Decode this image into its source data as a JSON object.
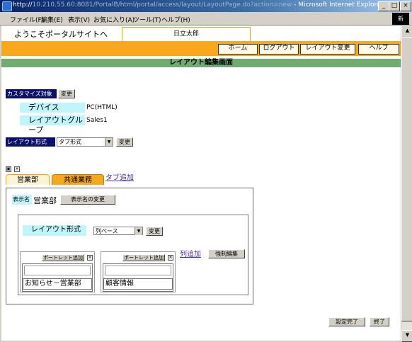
{
  "browser": {
    "title_prefix": "http://",
    "title_url": "10.210.55.60:8081/PortalB/html/portal/access/layout/LayoutPage.do?action=new",
    "title_suffix": " - Microsoft Internet Explorer",
    "menu": [
      "ファイル(F)",
      "編集(E)",
      "表示(V)",
      "お気に入り(A)",
      "ツール(T)",
      "ヘルプ(H)"
    ],
    "throbber": "新"
  },
  "header": {
    "welcome": "ようこそポータルサイトへ",
    "user": "日立太郎",
    "buttons": [
      "ホーム",
      "ログアウト",
      "レイアウト変更",
      "ヘルプ"
    ]
  },
  "page_title": "レイアウト編集画面",
  "customize": {
    "label": "カスタマイズ対象",
    "change_btn": "変更",
    "device_label": "デバイス",
    "device_value": "PC(HTML)",
    "group_label": "レイアウトグループ",
    "group_value": "Sales1"
  },
  "layout_format": {
    "label": "レイアウト形式",
    "selected": "タブ形式",
    "change_btn": "変更"
  },
  "tabs": {
    "items": [
      "営業部",
      "共通業務"
    ],
    "add_link": "タブ追加"
  },
  "tab_panel": {
    "display_name_label": "表示名",
    "display_name_value": "営業部",
    "rename_btn": "表示名の変更",
    "inner_layout_label": "レイアウト形式",
    "inner_layout_selected": "列ベース",
    "inner_change_btn": "変更",
    "add_column_link": "列追加",
    "force_edit_btn": "強制編集",
    "columns": [
      {
        "add_btn": "ポートレット追加",
        "portlet": "お知らせ－営業部"
      },
      {
        "add_btn": "ポートレット追加",
        "portlet": "顧客情報"
      }
    ]
  },
  "footer": {
    "done_btn": "設定完了",
    "close_btn": "終了"
  },
  "colors": {
    "orange": "#f8a81c",
    "green": "#6eac72",
    "navy": "#0b1166",
    "cyan": "#bff5fb"
  }
}
